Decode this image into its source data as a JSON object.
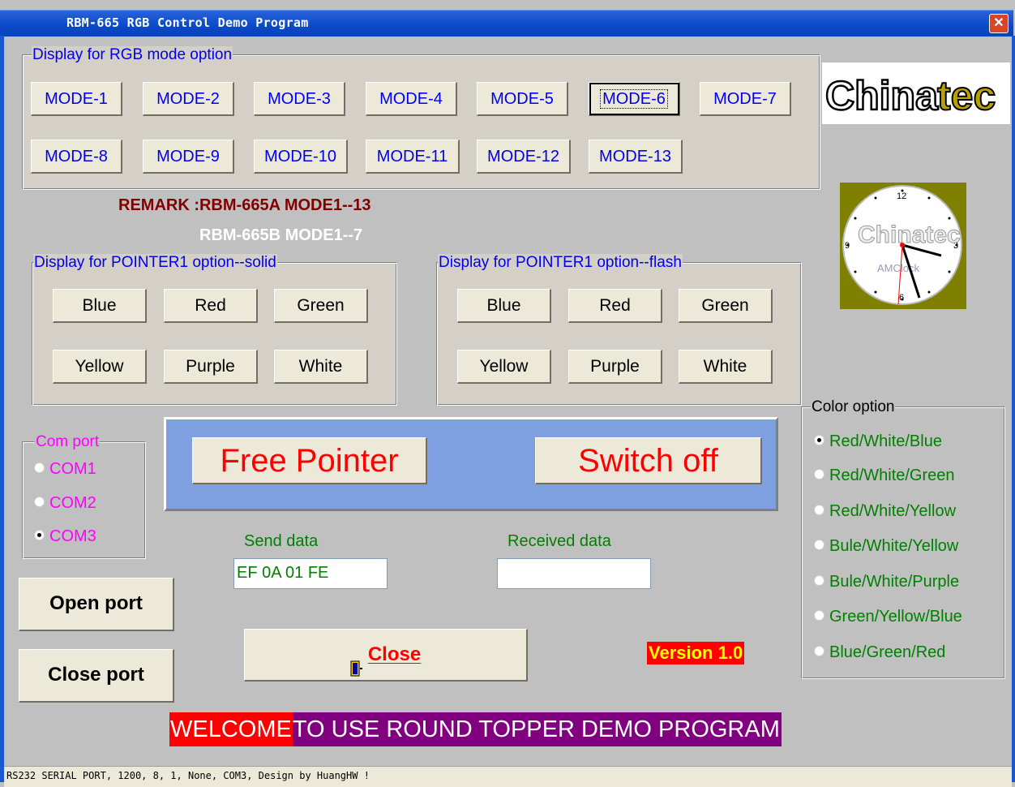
{
  "window": {
    "title": "RBM-665  RGB Control Demo Program",
    "close_glyph": "✕"
  },
  "mode_group": {
    "legend": "Display for RGB mode option",
    "buttons": [
      "MODE-1",
      "MODE-2",
      "MODE-3",
      "MODE-4",
      "MODE-5",
      "MODE-6",
      "MODE-7",
      "MODE-8",
      "MODE-9",
      "MODE-10",
      "MODE-11",
      "MODE-12",
      "MODE-13"
    ],
    "selected": "MODE-6"
  },
  "logo": {
    "text_a": "China",
    "text_b": "tec"
  },
  "clock": {
    "numerals": [
      "12",
      "3",
      "6",
      "9"
    ],
    "brand": "Chinatec",
    "sub": "AMClock"
  },
  "remarks": {
    "line1_label": "REMARK  :RBM-665A  MODE1--13",
    "line2_label": "RBM-665B  MODE1--7"
  },
  "pointer_solid": {
    "legend": "Display for POINTER1 option--solid",
    "buttons": [
      "Blue",
      "Red",
      "Green",
      "Yellow",
      "Purple",
      "White"
    ]
  },
  "pointer_flash": {
    "legend": "Display for POINTER1 option--flash",
    "buttons": [
      "Blue",
      "Red",
      "Green",
      "Yellow",
      "Purple",
      "White"
    ]
  },
  "com_port": {
    "legend": "Com port",
    "options": [
      "COM1",
      "COM2",
      "COM3"
    ],
    "selected": "COM3"
  },
  "main_buttons": {
    "free_pointer": "Free Pointer",
    "switch_off": "Switch off"
  },
  "send": {
    "label": "Send data",
    "value": "EF 0A 01 FE"
  },
  "received": {
    "label": "Received data",
    "value": ""
  },
  "port_buttons": {
    "open": "Open  port",
    "close": "Close port"
  },
  "close_button": {
    "label": "Close",
    "icon": "door-exit-icon"
  },
  "version": "Version 1.0",
  "color_option": {
    "legend": "Color option",
    "options": [
      "Red/White/Blue",
      "Red/White/Green",
      "Red/White/Yellow",
      "Bule/White/Yellow",
      "Bule/White/Purple",
      "Green/Yellow/Blue",
      "Blue/Green/Red"
    ],
    "selected": "Red/White/Blue"
  },
  "welcome": {
    "part1": "WELCOME",
    "part2": " TO USE ROUND TOPPER DEMO PROGRAM"
  },
  "status": "RS232 SERIAL PORT, 1200, 8, 1, None, COM3, Design by HuangHW !",
  "colors": {
    "title_bg": "#0a49c8",
    "mode_text": "#0000ee",
    "remark1": "#800000",
    "com_text": "#ff00ff",
    "field_text": "#008000",
    "big_btn_text": "#ff0000",
    "welcome_red_bg": "#ff0000",
    "welcome_purple_bg": "#800080",
    "version_bg": "#ff0000",
    "version_text": "#ffff00"
  }
}
